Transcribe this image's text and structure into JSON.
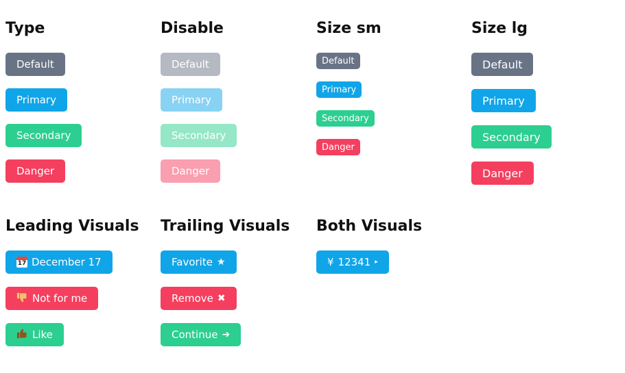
{
  "sections": {
    "type": {
      "heading": "Type",
      "buttons": [
        "Default",
        "Primary",
        "Secondary",
        "Danger"
      ]
    },
    "disable": {
      "heading": "Disable",
      "buttons": [
        "Default",
        "Primary",
        "Secondary",
        "Danger"
      ]
    },
    "size_sm": {
      "heading": "Size sm",
      "buttons": [
        "Default",
        "Primary",
        "Secondary",
        "Danger"
      ]
    },
    "size_lg": {
      "heading": "Size lg",
      "buttons": [
        "Default",
        "Primary",
        "Secondary",
        "Danger"
      ]
    },
    "leading": {
      "heading": "Leading Visuals",
      "buttons": [
        {
          "label": "December 17",
          "icon": "calendar-icon",
          "icon_text": "17"
        },
        {
          "label": "Not for me",
          "icon": "thumbs-down-icon"
        },
        {
          "label": "Like",
          "icon": "thumbs-up-icon"
        }
      ]
    },
    "trailing": {
      "heading": "Trailing Visuals",
      "buttons": [
        {
          "label": "Favorite",
          "icon": "star-icon",
          "glyph": "★"
        },
        {
          "label": "Remove",
          "icon": "x-icon",
          "glyph": "✖"
        },
        {
          "label": "Continue",
          "icon": "arrow-right-icon",
          "glyph": "➔"
        }
      ]
    },
    "both": {
      "heading": "Both Visuals",
      "buttons": [
        {
          "label": "12341",
          "lead_glyph": "¥",
          "trail_glyph": "▸"
        }
      ]
    }
  },
  "colors": {
    "default": "#687385",
    "primary": "#10a5e8",
    "secondary": "#2ccf8f",
    "danger": "#f43f5f"
  }
}
